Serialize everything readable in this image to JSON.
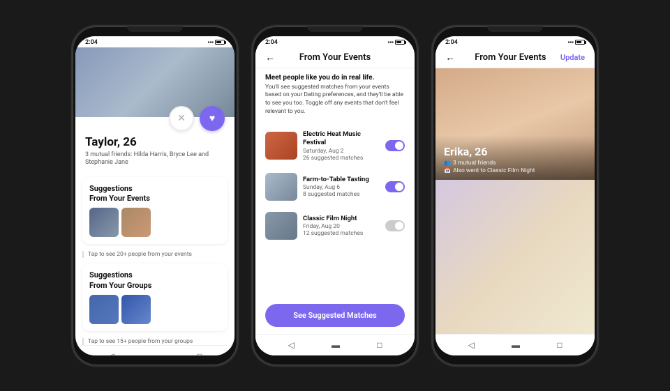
{
  "phones": [
    {
      "id": "phone1",
      "status_time": "2:04",
      "profile": {
        "name": "Taylor, 26",
        "friends": "3 mutual friends: Hilda Harris, Bryce Lee and Stephanie Jane"
      },
      "sections": [
        {
          "title": "Suggestions\nFrom Your Events",
          "tap_hint": "Tap to see 20+ people from your events"
        },
        {
          "title": "Suggestions\nFrom Your Groups",
          "tap_hint": "Tap to see 15+ people from your groups"
        }
      ]
    },
    {
      "id": "phone2",
      "status_time": "2:04",
      "screen_title": "From Your Events",
      "intro_bold": "Meet people like you do in real life.",
      "intro_body": "You'll see suggested matches from your events based on your Dating preferences, and they'll be able to see you too. Toggle off any events that don't feel relevant to you.",
      "events": [
        {
          "name": "Electric Heat Music Festival",
          "date": "Saturday, Aug 2",
          "matches": "26 suggested matches",
          "thumb_class": "e1"
        },
        {
          "name": "Farm-to-Table Tasting",
          "date": "Sunday, Aug 6",
          "matches": "8 suggested matches",
          "thumb_class": "e2"
        },
        {
          "name": "Classic Film Night",
          "date": "Friday, Aug 20",
          "matches": "12 suggested matches",
          "thumb_class": "e3"
        }
      ],
      "see_btn": "See Suggested Matches"
    },
    {
      "id": "phone3",
      "status_time": "2:04",
      "screen_title": "From Your Events",
      "update_label": "Update",
      "profile": {
        "name": "Erika, 26",
        "friends": "3 mutual friends",
        "event": "Also went to Classic Film Night"
      }
    }
  ]
}
